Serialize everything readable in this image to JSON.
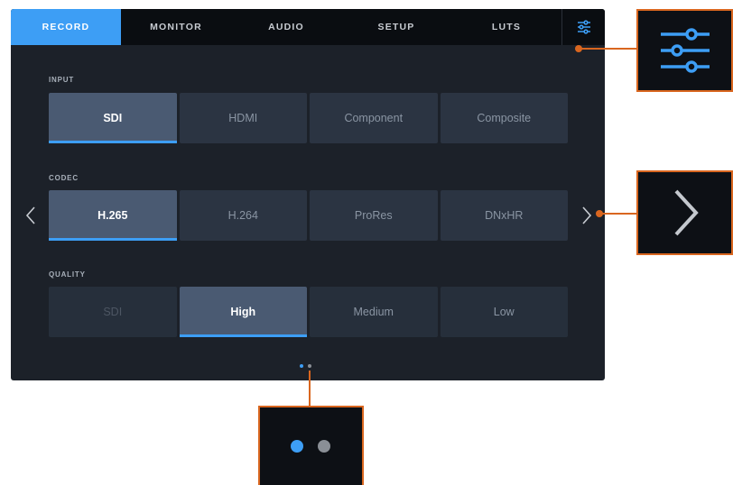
{
  "tabs": [
    {
      "label": "RECORD",
      "active": true
    },
    {
      "label": "MONITOR",
      "active": false
    },
    {
      "label": "AUDIO",
      "active": false
    },
    {
      "label": "SETUP",
      "active": false
    },
    {
      "label": "LUTS",
      "active": false
    }
  ],
  "settings_icon": "sliders-icon",
  "sections": {
    "input": {
      "label": "INPUT",
      "options": [
        "SDI",
        "HDMI",
        "Component",
        "Composite"
      ],
      "selected": "SDI"
    },
    "codec": {
      "label": "CODEC",
      "options": [
        "H.265",
        "H.264",
        "ProRes",
        "DNxHR"
      ],
      "selected": "H.265"
    },
    "quality": {
      "label": "QUALITY",
      "options": [
        "SDI",
        "High",
        "Medium",
        "Low"
      ],
      "selected": "High",
      "disabled": [
        "SDI"
      ]
    }
  },
  "nav": {
    "prev_icon": "chevron-left-icon",
    "next_icon": "chevron-right-icon"
  },
  "pagination": {
    "pages": 2,
    "current_page": 1
  },
  "callouts": [
    "sliders-icon",
    "chevron-right-icon",
    "page-dots-icon"
  ],
  "colors": {
    "accent": "#3d9ef5",
    "callout_border": "#d9661f",
    "panel_background": "#1c2129",
    "tabbar_background": "#0a0d11",
    "inactive_dot": "#8a8f96"
  }
}
